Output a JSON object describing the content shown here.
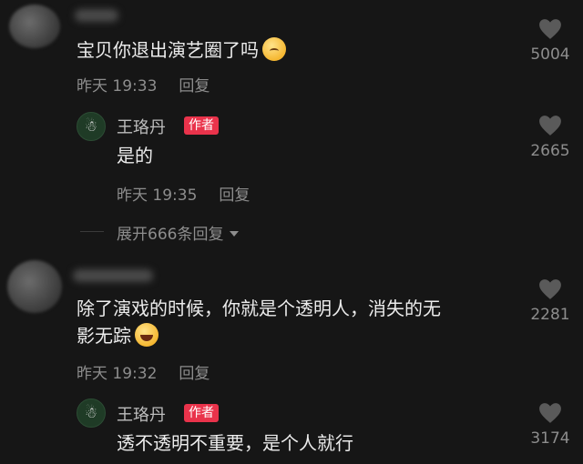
{
  "comments": [
    {
      "text": "宝贝你退出演艺圈了吗",
      "emoji": "sleepy-face-emoji",
      "time": "昨天 19:33",
      "reply_label": "回复",
      "likes": "5004",
      "replies": [
        {
          "author": "王珞丹",
          "badge": "作者",
          "text": "是的",
          "time": "昨天 19:35",
          "reply_label": "回复",
          "likes": "2665"
        }
      ],
      "expand_label": "展开666条回复"
    },
    {
      "text_line1": "除了演戏的时候，你就是个透明人，消失的无",
      "text_line2": "影无踪",
      "emoji": "laughing-tears-emoji",
      "time": "昨天 19:32",
      "reply_label": "回复",
      "likes": "2281",
      "replies": [
        {
          "author": "王珞丹",
          "badge": "作者",
          "text": "透不透明不重要，是个人就行",
          "likes": "3174"
        }
      ]
    }
  ],
  "colors": {
    "background": "#161616",
    "badge": "#e9334b",
    "muted_text": "#8d8d8d"
  }
}
